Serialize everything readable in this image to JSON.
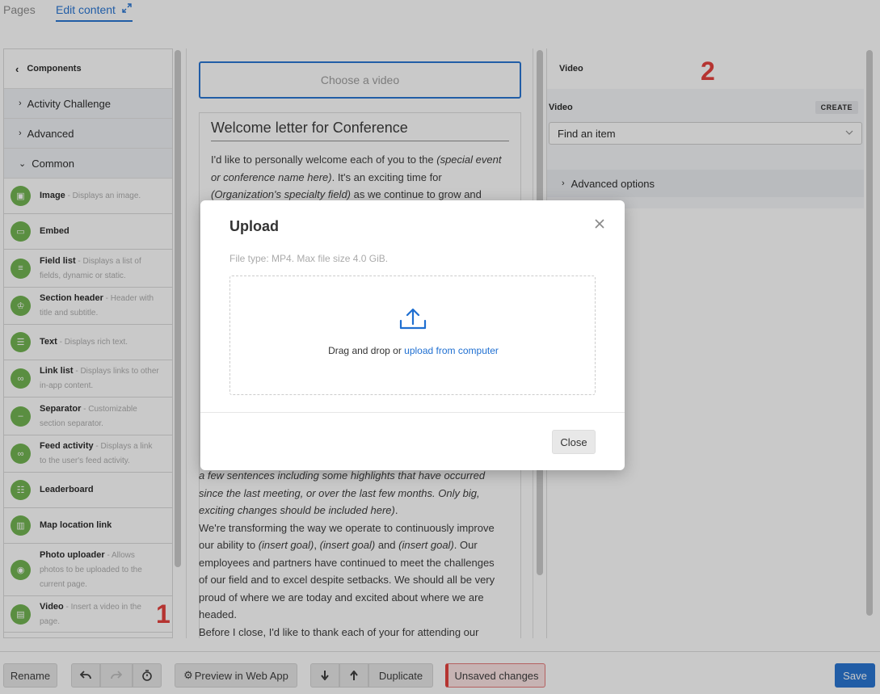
{
  "tabs": {
    "pages": "Pages",
    "edit_content": "Edit content"
  },
  "components": {
    "header": "Components",
    "categories": [
      "Activity Challenge",
      "Advanced",
      "Common"
    ],
    "items": [
      {
        "name": "Image",
        "desc": " - Displays an image.",
        "icon": "image-icon"
      },
      {
        "name": "Embed",
        "desc": "",
        "icon": "embed-icon"
      },
      {
        "name": "Field list",
        "desc": " - Displays a list of fields, dynamic or static.",
        "icon": "list-icon"
      },
      {
        "name": "Section header",
        "desc": " - Header with title and subtitle.",
        "icon": "trophy-icon"
      },
      {
        "name": "Text",
        "desc": " - Displays rich text.",
        "icon": "text-icon"
      },
      {
        "name": "Link list",
        "desc": " - Displays links to other in-app content.",
        "icon": "link-icon"
      },
      {
        "name": "Separator",
        "desc": " - Customizable section separator.",
        "icon": "minus-icon"
      },
      {
        "name": "Feed activity",
        "desc": " - Displays a link to the user's feed activity.",
        "icon": "link-icon"
      },
      {
        "name": "Leaderboard",
        "desc": "",
        "icon": "leaderboard-icon"
      },
      {
        "name": "Map location link",
        "desc": "",
        "icon": "map-icon"
      },
      {
        "name": "Photo uploader",
        "desc": " - Allows photos to be uploaded to the current page.",
        "icon": "camera-icon"
      },
      {
        "name": "Video",
        "desc": " - Insert a video in the page.",
        "icon": "video-icon"
      }
    ],
    "marker": "1"
  },
  "editor": {
    "choose_video": "Choose a video",
    "letter_title": "Welcome letter for Conference",
    "p1_a": "I'd like to personally welcome each of you to the ",
    "p1_b": "(special event or conference name here)",
    "p1_c": ". It's an exciting time for ",
    "p1_d": "(Organization's specialty field)",
    "p1_e": " as we continue to grow and",
    "p2": "a few sentences including some highlights that have occurred since the last meeting, or over the last few months. Only big, exciting changes should be included here)",
    "p2_end": ".",
    "p3_a": "We're transforming the way we operate to continuously improve our ability to ",
    "p3_b": "(insert goal)",
    "p3_c": ", ",
    "p3_d": "(insert goal)",
    "p3_e": " and ",
    "p3_f": "(insert goal)",
    "p3_g": ". Our employees and partners have continued to meet the challenges of our field and to excel despite setbacks. We should all be very proud of where we are today and excited about where we are headed.",
    "p4": "Before I close, I'd like to thank each of your for attending our"
  },
  "settings": {
    "title": "Video",
    "marker": "2",
    "video_label": "Video",
    "create": "CREATE",
    "select_placeholder": "Find an item",
    "advanced": "Advanced options"
  },
  "modal": {
    "title": "Upload",
    "file_type": "File type: MP4. Max file size 4.0 GiB.",
    "drop_text": "Drag and drop or ",
    "drop_link": "upload from computer",
    "close": "Close"
  },
  "toolbar": {
    "rename": "Rename",
    "preview": "Preview in Web App",
    "duplicate": "Duplicate",
    "unsaved": "Unsaved changes",
    "save": "Save"
  },
  "colors": {
    "accent": "#1f6fd1",
    "component_icon": "#6bb04a",
    "marker": "#e53935"
  }
}
